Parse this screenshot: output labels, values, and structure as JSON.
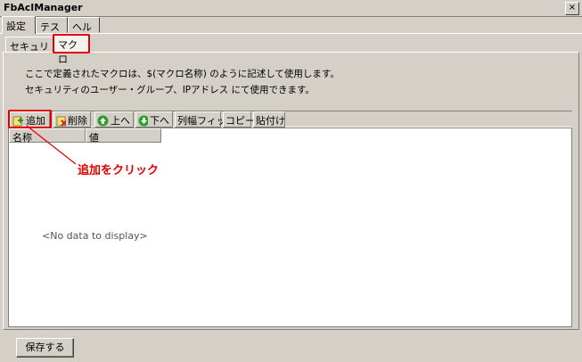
{
  "window": {
    "title": "FbAclManager",
    "close_symbol": "×"
  },
  "top_tabs": [
    {
      "label": "設定"
    },
    {
      "label": "テスト"
    },
    {
      "label": "ヘルプ"
    }
  ],
  "inner_tabs": [
    {
      "label": "セキュリティ"
    },
    {
      "label": "マクロ"
    }
  ],
  "description": {
    "line1": "ここで定義されたマクロは、$(マクロ名称)  のように記述して使用します。",
    "line2": "セキュリティのユーザー・グループ、IPアドレス  にて使用できます。"
  },
  "toolbar": {
    "add": "追加",
    "delete": "削除",
    "up": "上へ",
    "down": "下へ",
    "fit_columns": "列幅フィット",
    "copy": "コピー",
    "paste": "貼付け"
  },
  "grid": {
    "columns": [
      "名称",
      "値"
    ],
    "empty_text": "<No data to display>"
  },
  "annotation": {
    "callout": "追加をクリック",
    "color": "#e00000"
  },
  "footer": {
    "save": "保存する"
  }
}
